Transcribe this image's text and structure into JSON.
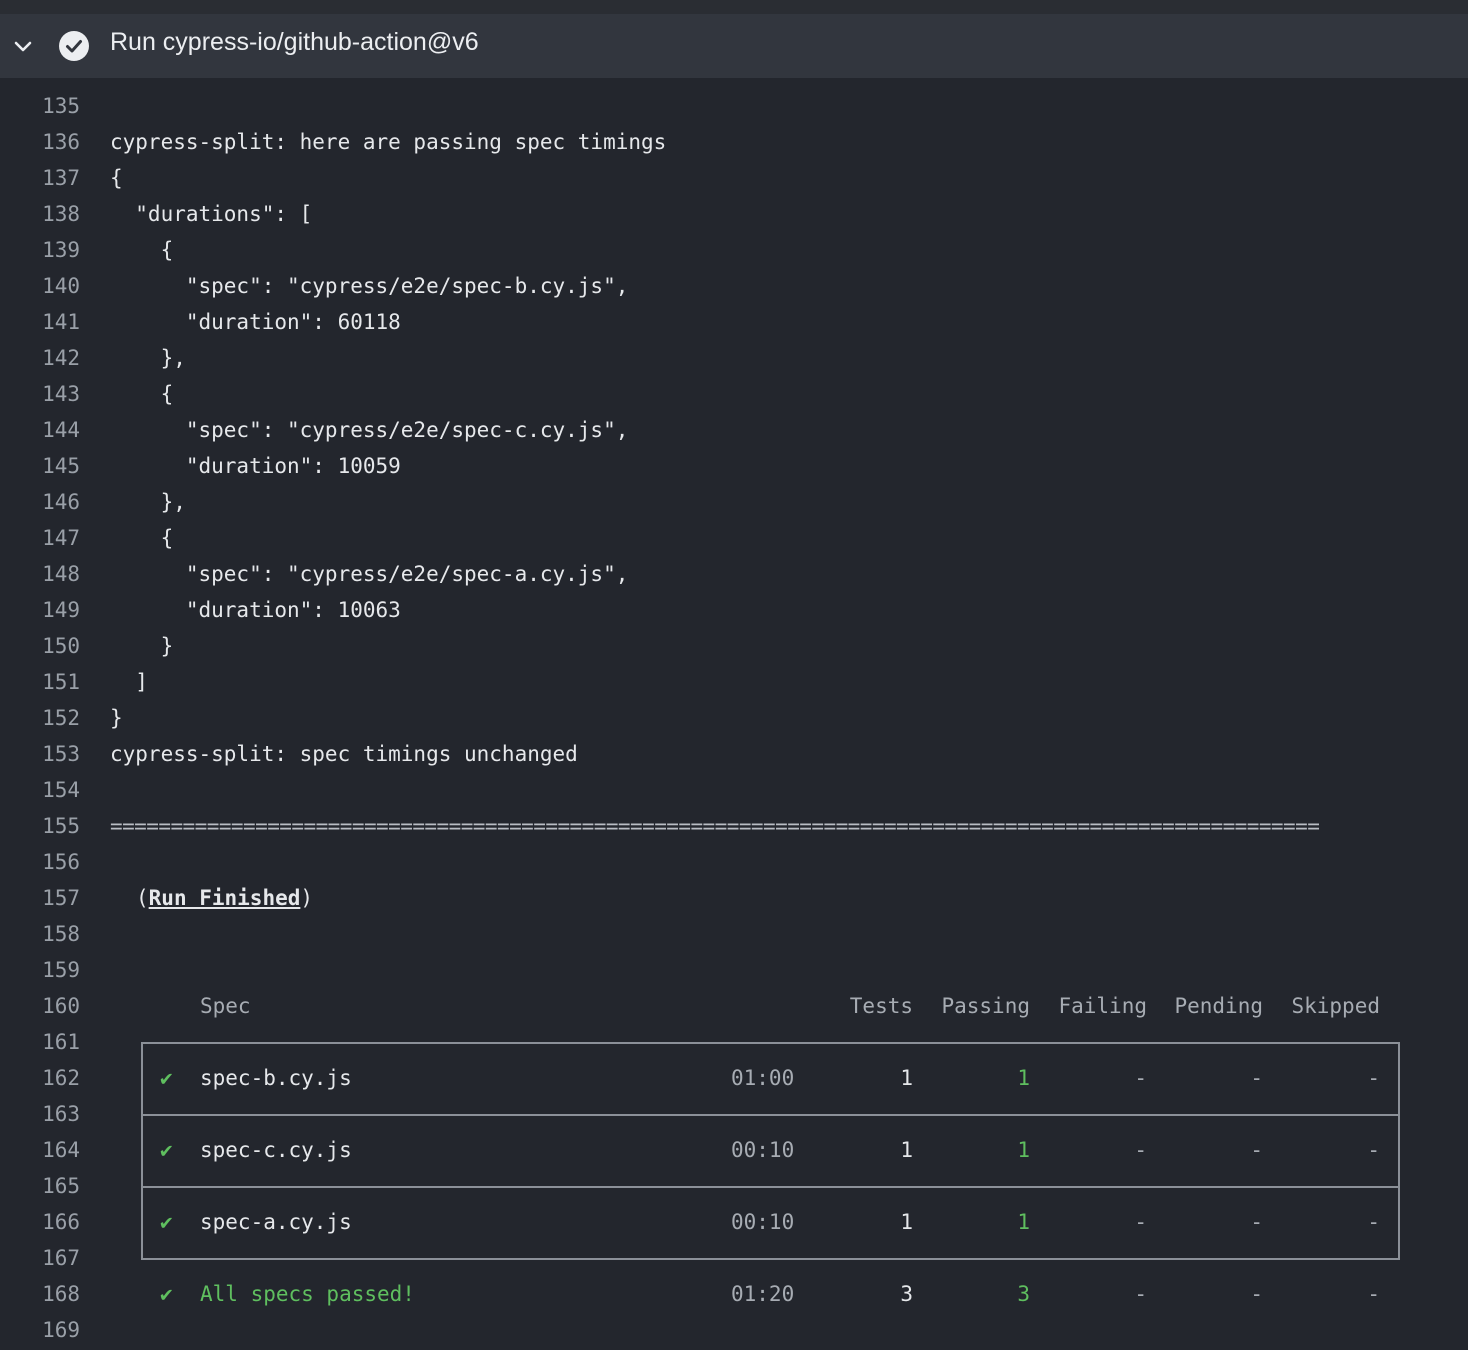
{
  "header": {
    "title": "Run cypress-io/github-action@v6",
    "status": "success",
    "icons": [
      "chevron-down-icon",
      "check-circle-icon"
    ]
  },
  "log": {
    "lines": [
      {
        "n": "135",
        "text": ""
      },
      {
        "n": "136",
        "text": "cypress-split: here are passing spec timings"
      },
      {
        "n": "137",
        "text": "{"
      },
      {
        "n": "138",
        "text": "  \"durations\": ["
      },
      {
        "n": "139",
        "text": "    {"
      },
      {
        "n": "140",
        "text": "      \"spec\": \"cypress/e2e/spec-b.cy.js\","
      },
      {
        "n": "141",
        "text": "      \"duration\": 60118"
      },
      {
        "n": "142",
        "text": "    },"
      },
      {
        "n": "143",
        "text": "    {"
      },
      {
        "n": "144",
        "text": "      \"spec\": \"cypress/e2e/spec-c.cy.js\","
      },
      {
        "n": "145",
        "text": "      \"duration\": 10059"
      },
      {
        "n": "146",
        "text": "    },"
      },
      {
        "n": "147",
        "text": "    {"
      },
      {
        "n": "148",
        "text": "      \"spec\": \"cypress/e2e/spec-a.cy.js\","
      },
      {
        "n": "149",
        "text": "      \"duration\": 10063"
      },
      {
        "n": "150",
        "text": "    }"
      },
      {
        "n": "151",
        "text": "  ]"
      },
      {
        "n": "152",
        "text": "}"
      },
      {
        "n": "153",
        "text": "cypress-split: spec timings unchanged"
      },
      {
        "n": "154",
        "text": ""
      },
      {
        "n": "155",
        "text": "===================================================================================================="
      },
      {
        "n": "156",
        "text": ""
      },
      {
        "n": "157",
        "text": ""
      },
      {
        "n": "158",
        "text": ""
      },
      {
        "n": "159",
        "text": ""
      },
      {
        "n": "160",
        "text": ""
      },
      {
        "n": "161",
        "text": ""
      },
      {
        "n": "162",
        "text": ""
      },
      {
        "n": "163",
        "text": ""
      },
      {
        "n": "164",
        "text": ""
      },
      {
        "n": "165",
        "text": ""
      },
      {
        "n": "166",
        "text": ""
      },
      {
        "n": "167",
        "text": ""
      },
      {
        "n": "168",
        "text": ""
      },
      {
        "n": "169",
        "text": ""
      }
    ],
    "run_finished": {
      "open": "(",
      "label": "Run Finished",
      "close": ")"
    }
  },
  "results": {
    "columns": {
      "spec": "Spec",
      "tests": "Tests",
      "passing": "Passing",
      "failing": "Failing",
      "pending": "Pending",
      "skipped": "Skipped"
    },
    "check": "✔",
    "rows": [
      {
        "spec": "spec-b.cy.js",
        "time": "01:00",
        "tests": "1",
        "passing": "1",
        "failing": "-",
        "pending": "-",
        "skipped": "-"
      },
      {
        "spec": "spec-c.cy.js",
        "time": "00:10",
        "tests": "1",
        "passing": "1",
        "failing": "-",
        "pending": "-",
        "skipped": "-"
      },
      {
        "spec": "spec-a.cy.js",
        "time": "00:10",
        "tests": "1",
        "passing": "1",
        "failing": "-",
        "pending": "-",
        "skipped": "-"
      }
    ],
    "summary": {
      "label": "All specs passed!",
      "time": "01:20",
      "tests": "3",
      "passing": "3",
      "failing": "-",
      "pending": "-",
      "skipped": "-"
    }
  },
  "colors": {
    "background": "#23262d",
    "header": "#32363e",
    "success": "#5fbf5f",
    "line_number": "#9aa0a8"
  }
}
